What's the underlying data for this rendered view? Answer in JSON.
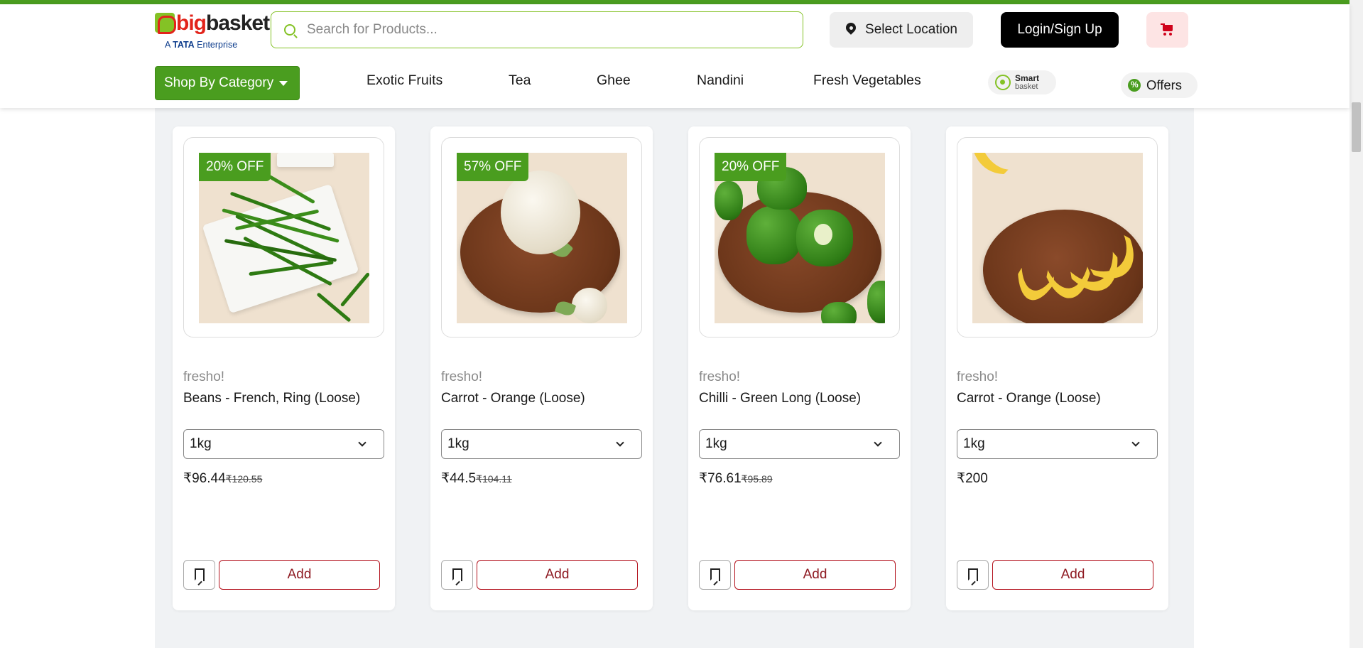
{
  "header": {
    "logo": {
      "brand_big": "big",
      "brand_basket": "basket",
      "tagline_prefix": "A",
      "tagline_tata": "TATA",
      "tagline_suffix": "Enterprise"
    },
    "search": {
      "placeholder": "Search for Products..."
    },
    "location_label": "Select Location",
    "login_label": "Login/Sign Up",
    "colors": {
      "brand_green": "#4a9d1f",
      "accent_red": "#b3121d",
      "cart_bg": "#fde4e4"
    }
  },
  "nav": {
    "shop_by_category": "Shop By Category",
    "items": [
      "Exotic Fruits",
      "Tea",
      "Ghee",
      "Nandini",
      "Fresh Vegetables"
    ],
    "smart_basket": {
      "line1": "Smart",
      "line2": "basket"
    },
    "offers_label": "Offers"
  },
  "products": [
    {
      "badge": "20% OFF",
      "brand": "fresho!",
      "name": "Beans - French, Ring (Loose)",
      "qty": "1kg",
      "price": "₹96.44",
      "mrp": "₹120.55",
      "add_label": "Add",
      "image": "green-beans"
    },
    {
      "badge": "57% OFF",
      "brand": "fresho!",
      "name": "Carrot - Orange (Loose)",
      "qty": "1kg",
      "price": "₹44.5",
      "mrp": "₹104.11",
      "add_label": "Add",
      "image": "cauliflower"
    },
    {
      "badge": "20% OFF",
      "brand": "fresho!",
      "name": "Chilli - Green Long (Loose)",
      "qty": "1kg",
      "price": "₹76.61",
      "mrp": "₹95.89",
      "add_label": "Add",
      "image": "capsicum"
    },
    {
      "badge": "",
      "brand": "fresho!",
      "name": "Carrot - Orange (Loose)",
      "qty": "1kg",
      "price": "₹200",
      "mrp": "",
      "add_label": "Add",
      "image": "banana"
    }
  ]
}
